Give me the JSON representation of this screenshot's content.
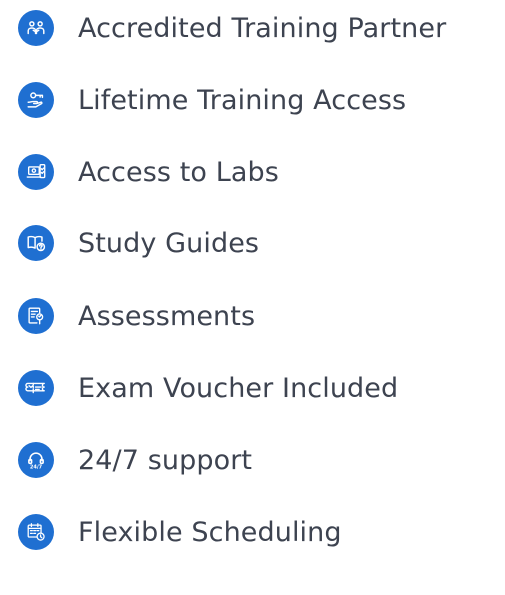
{
  "features": {
    "accent_color": "#1f6fd1",
    "items": [
      {
        "label": "Accredited Training Partner",
        "icon": "partner-people-icon"
      },
      {
        "label": "Lifetime Training Access",
        "icon": "key-hand-icon"
      },
      {
        "label": "Access to Labs",
        "icon": "laptop-lab-icon"
      },
      {
        "label": "Study Guides",
        "icon": "book-question-icon"
      },
      {
        "label": "Assessments",
        "icon": "document-magnifier-icon"
      },
      {
        "label": "Exam Voucher Included",
        "icon": "voucher-ticket-icon"
      },
      {
        "label": "24/7 support",
        "icon": "headset-247-icon"
      },
      {
        "label": "Flexible Scheduling",
        "icon": "calendar-clock-icon"
      }
    ]
  }
}
